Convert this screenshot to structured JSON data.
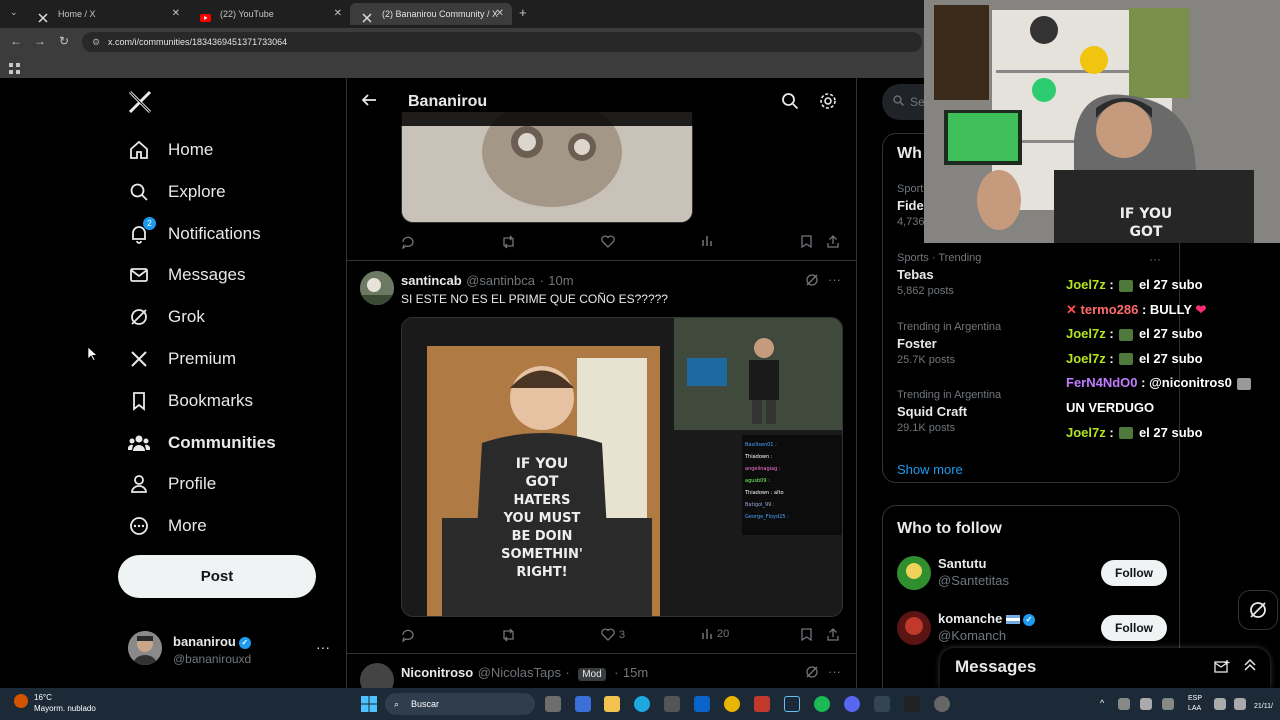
{
  "browser": {
    "tabs": [
      {
        "title": "Home / X"
      },
      {
        "title": "(22) YouTube"
      },
      {
        "title": "(2) Bananirou Community / X"
      }
    ],
    "new_tab": "+",
    "url": "x.com/i/communities/1834369451371733064"
  },
  "sidebar": {
    "nav": [
      {
        "label": "Home",
        "icon": "home-icon"
      },
      {
        "label": "Explore",
        "icon": "search-icon"
      },
      {
        "label": "Notifications",
        "icon": "bell-icon",
        "badge": "2"
      },
      {
        "label": "Messages",
        "icon": "envelope-icon"
      },
      {
        "label": "Grok",
        "icon": "grok-icon"
      },
      {
        "label": "Premium",
        "icon": "x-logo-icon"
      },
      {
        "label": "Bookmarks",
        "icon": "bookmark-icon"
      },
      {
        "label": "Communities",
        "icon": "people-icon"
      },
      {
        "label": "Profile",
        "icon": "person-icon"
      },
      {
        "label": "More",
        "icon": "more-circle-icon"
      }
    ],
    "post_label": "Post",
    "account": {
      "name": "bananirou",
      "handle": "@bananirouxd"
    }
  },
  "main": {
    "title": "Bananirou",
    "posts": [
      {
        "name": "santincab",
        "handle": "@santinbca",
        "time": "10m",
        "text": "SI ESTE NO ES EL PRIME QUE COÑO ES?????",
        "image_text": "IF YOU GOT HATERS YOU MUST BE DOIN SOMETHIN' RIGHT!",
        "chat_names": [
          "Basilisen01 :",
          "Thiadown :",
          "angelinagiag :",
          "agusb09 :",
          "Thiadown : alto",
          "Batigol_99 :",
          "George_Floyd25 :"
        ],
        "likes": "3",
        "views": "20"
      },
      {
        "name": "Niconitroso",
        "handle": "@NicolasTaps",
        "badge": "Mod",
        "time": "15m"
      }
    ]
  },
  "right": {
    "search_placeholder": "Se",
    "trends_title": "Wh",
    "trends": [
      {
        "meta": "Sports",
        "topic": "Fide",
        "count": "4,736"
      },
      {
        "meta": "Sports · Trending",
        "topic": "Tebas",
        "count": "5,862 posts"
      },
      {
        "meta": "Trending in Argentina",
        "topic": "Foster",
        "count": "25.7K posts"
      },
      {
        "meta": "Trending in Argentina",
        "topic": "Squid Craft",
        "count": "29.1K posts"
      }
    ],
    "show_more": "Show more",
    "who_to_follow": {
      "title": "Who to follow",
      "accounts": [
        {
          "name": "Santutu",
          "handle": "@Santetitas",
          "follow": "Follow"
        },
        {
          "name": "komanche",
          "handle": "@Komanch",
          "follow": "Follow"
        }
      ]
    },
    "messages_title": "Messages"
  },
  "stream_overlay": {
    "shirt_text": "IF YOU GOT",
    "chat": [
      {
        "user": "Joel7z",
        "msg": "el 27 subo",
        "color": "#b5e61d"
      },
      {
        "user": "termo286",
        "msg": "BULLY",
        "color": "#ff6b6b"
      },
      {
        "user": "Joel7z",
        "msg": "el 27 subo",
        "color": "#b5e61d"
      },
      {
        "user": "Joel7z",
        "msg": "el 27 subo",
        "color": "#b5e61d"
      },
      {
        "user": "FerN4NdO0",
        "msg": "@niconitros0",
        "color": "#c07bff"
      },
      {
        "user": "",
        "msg": "UN VERDUGO",
        "color": "#fff"
      },
      {
        "user": "Joel7z",
        "msg": "el 27 subo",
        "color": "#b5e61d"
      }
    ]
  },
  "taskbar": {
    "weather_temp": "16°C",
    "weather_desc": "Mayorm. nublado",
    "search_label": "Buscar",
    "lang": "ESP",
    "lang_sub": "LAA",
    "date": "21/11/"
  }
}
